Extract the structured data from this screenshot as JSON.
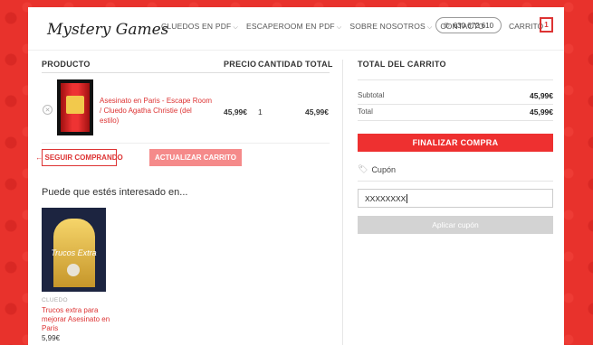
{
  "header": {
    "logo": "Mystery Games",
    "nav": [
      {
        "label": "CLUEDOS EN PDF",
        "has_dropdown": true
      },
      {
        "label": "ESCAPEROOM EN PDF",
        "has_dropdown": true
      },
      {
        "label": "SOBRE NOSOTROS",
        "has_dropdown": true
      },
      {
        "label": "CONTACTO",
        "has_dropdown": false
      }
    ],
    "phone": "630 672 610",
    "cart_label": "CARRITO",
    "cart_count": "1"
  },
  "cart_table": {
    "headers": {
      "product": "PRODUCTO",
      "price": "PRECIO",
      "quantity": "CANTIDAD",
      "total": "TOTAL"
    },
    "rows": [
      {
        "name": "Asesinato en Paris - Escape Room / Cluedo Agatha Christie (del estilo)",
        "price": "45,99€",
        "quantity": "1",
        "total": "45,99€"
      }
    ]
  },
  "buttons": {
    "continue": "← SEGUIR COMPRANDO",
    "update": "ACTUALIZAR CARRITO",
    "checkout": "FINALIZAR COMPRA",
    "apply_coupon": "Aplicar cupón"
  },
  "related": {
    "title": "Puede que estés interesado en...",
    "items": [
      {
        "category": "CLUEDO",
        "name": "Trucos extra para mejorar Asesinato en Paris",
        "price": "5,99€",
        "cover_text": "Trucos Extra"
      }
    ]
  },
  "totals": {
    "title": "TOTAL DEL CARRITO",
    "subtotal_label": "Subtotal",
    "subtotal_value": "45,99€",
    "total_label": "Total",
    "total_value": "45,99€"
  },
  "coupon": {
    "label": "Cupón",
    "value": "XXXXXXXX"
  },
  "colors": {
    "accent": "#ee3030",
    "link": "#d33333",
    "background": "#e8322c"
  }
}
